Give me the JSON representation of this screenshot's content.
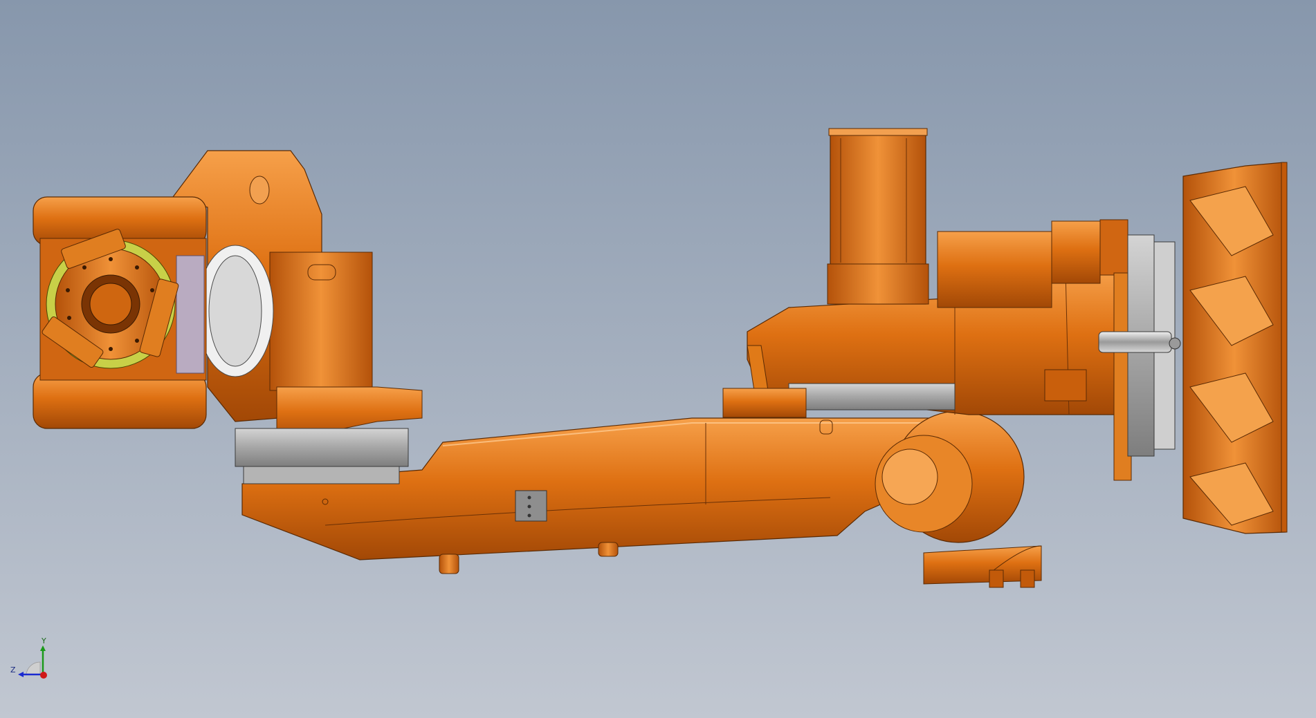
{
  "viewport": {
    "background_top": "#8797ac",
    "background_bottom": "#c1c7d1"
  },
  "model": {
    "body_color": "#d86a10",
    "body_highlight": "#f29a3c",
    "body_shadow": "#8a3a05",
    "bearing_color": "#a9a9a9",
    "glass_color": "#b6b8e0",
    "accent_yellow": "#c8d048"
  },
  "triad": {
    "x_label": "",
    "y_label": "Y",
    "z_label": "Z",
    "x_color": "#d01818",
    "y_color": "#1a9a1a",
    "z_color": "#1a2ad0"
  }
}
